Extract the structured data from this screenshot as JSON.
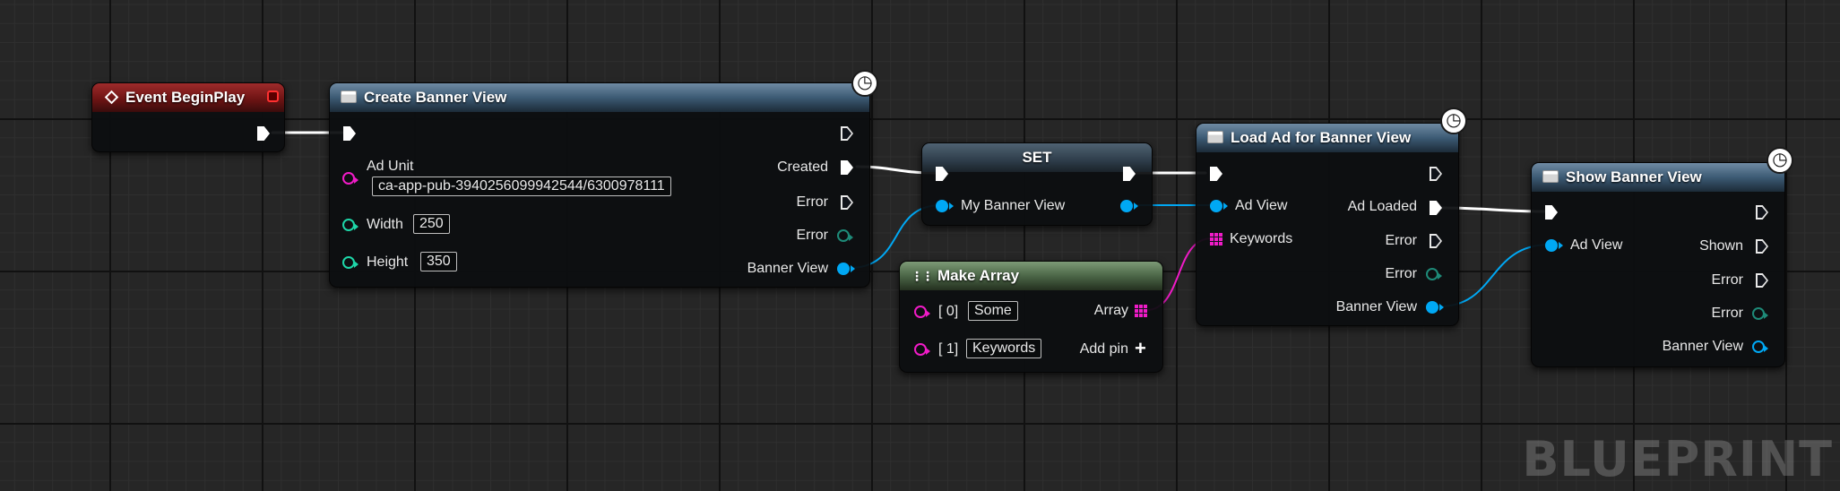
{
  "colors": {
    "exec": "#ffffff",
    "object_pin": "#00a8f4",
    "string_pin": "#f01bc7",
    "int_pin": "#1ed6a8",
    "array_pin": "#f01bc7",
    "error_pin": "#1e8a78",
    "event_header": "#8b1f1f",
    "function_header": "#4a6b88",
    "make_array_header": "#5e7d58"
  },
  "nodes": {
    "event_begin_play": {
      "title": "Event BeginPlay",
      "icon": "event-diamond-icon"
    },
    "create_banner_view": {
      "title": "Create Banner View",
      "icon": "function-icon",
      "latent_icon": "clock-icon",
      "ad_unit": {
        "label": "Ad Unit",
        "value": "ca-app-pub-3940256099942544/6300978111"
      },
      "width": {
        "label": "Width",
        "value": "250"
      },
      "height": {
        "label": "Height",
        "value": "350"
      },
      "out_created": "Created",
      "out_error_exec": "Error",
      "out_error": "Error",
      "out_banner_view": "Banner View"
    },
    "set_node": {
      "title": "SET",
      "in_label": "My Banner View"
    },
    "make_array": {
      "title": "Make Array",
      "icon": "make-array-icon",
      "item0": {
        "label": "[ 0]",
        "value": "Some"
      },
      "item1": {
        "label": "[ 1]",
        "value": "Keywords"
      },
      "out_array": "Array",
      "add_pin": "Add pin"
    },
    "load_ad": {
      "title": "Load Ad for Banner View",
      "icon": "function-icon",
      "latent_icon": "clock-icon",
      "in_ad_view": "Ad View",
      "in_keywords": "Keywords",
      "out_ad_loaded": "Ad Loaded",
      "out_error_exec": "Error",
      "out_error": "Error",
      "out_banner_view": "Banner View"
    },
    "show_banner": {
      "title": "Show Banner View",
      "icon": "function-icon",
      "latent_icon": "clock-icon",
      "in_ad_view": "Ad View",
      "out_shown": "Shown",
      "out_error_exec": "Error",
      "out_error": "Error",
      "out_banner_view": "Banner View"
    }
  },
  "watermark": "BLUEPRINT"
}
